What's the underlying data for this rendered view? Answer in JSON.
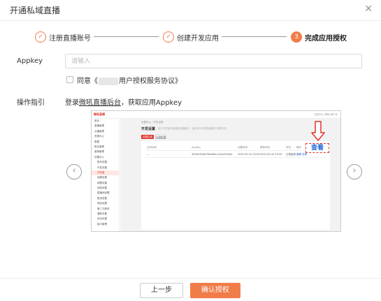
{
  "dialog": {
    "title": "开通私域直播",
    "close_icon": "✕"
  },
  "steps": [
    {
      "index": "✓",
      "label": "注册直播账号",
      "state": "done"
    },
    {
      "index": "✓",
      "label": "创建开发应用",
      "state": "done"
    },
    {
      "index": "3",
      "label": "完成应用授权",
      "state": "active"
    }
  ],
  "form": {
    "appkey_label": "Appkey",
    "appkey_placeholder": "请输入",
    "agree_prefix": "同意《",
    "agree_suffix": "用户授权服务协议》",
    "guide_label": "操作指引",
    "guide_prefix": "登录",
    "guide_link": "微吼直播后台",
    "guide_suffix": "，获取应用Appkey"
  },
  "screenshot": {
    "logo": "微吼直播",
    "top_right": "文档中心   帮助   用户名",
    "sidebar": [
      {
        "label": "首页",
        "sub": false,
        "hl": false
      },
      {
        "label": "直播管理",
        "sub": false,
        "hl": false
      },
      {
        "label": "点播管理",
        "sub": false,
        "hl": false
      },
      {
        "label": "资源中心",
        "sub": false,
        "hl": false
      },
      {
        "label": "数据",
        "sub": false,
        "hl": false
      },
      {
        "label": "粉丝管理",
        "sub": false,
        "hl": false
      },
      {
        "label": "营销管理",
        "sub": false,
        "hl": false
      },
      {
        "label": "设置中心",
        "sub": false,
        "hl": false
      },
      {
        "label": "账号设置",
        "sub": true,
        "hl": false
      },
      {
        "label": "开发设置",
        "sub": true,
        "hl": false
      },
      {
        "label": "开发者",
        "sub": true,
        "hl": true
      },
      {
        "label": "品牌设置",
        "sub": true,
        "hl": false
      },
      {
        "label": "观看设置",
        "sub": true,
        "hl": false
      },
      {
        "label": "回放设置",
        "sub": true,
        "hl": false
      },
      {
        "label": "直播间设置",
        "sub": true,
        "hl": false
      },
      {
        "label": "推流设置",
        "sub": true,
        "hl": false
      },
      {
        "label": "商品设置",
        "sub": true,
        "hl": false
      },
      {
        "label": "第三方服务",
        "sub": true,
        "hl": false
      },
      {
        "label": "通知设置",
        "sub": true,
        "hl": false
      },
      {
        "label": "安全设置",
        "sub": true,
        "hl": false
      },
      {
        "label": "接口管理",
        "sub": true,
        "hl": false
      }
    ],
    "crumb": "设置中心 / 开发设置",
    "page_title": "开发设置",
    "page_sub": "用于开发者对接微吼直播能力，通过API实现快速集成  查看文档",
    "btn_create": "创建应用",
    "btn_manage": "回调配置",
    "headers": [
      "应用名称",
      "AppKey",
      "创建时间",
      "更新时间",
      "状态",
      "操作"
    ],
    "row": [
      "—",
      "3b3f4c5d6e7f8a9b0c1d2e3f4a5b",
      "2022-05-20 10:00",
      "2022-05-20 10:00",
      "正常使用",
      "编辑 查看"
    ],
    "view_label": "查看",
    "arrow_icon": "down-arrow-icon"
  },
  "nav": {
    "prev_icon": "‹",
    "next_icon": "›"
  },
  "footer": {
    "prev_label": "上一步",
    "confirm_label": "确认授权"
  },
  "colors": {
    "accent": "#f07c4a",
    "highlight": "#e0332a",
    "link": "#2b6cd9"
  }
}
